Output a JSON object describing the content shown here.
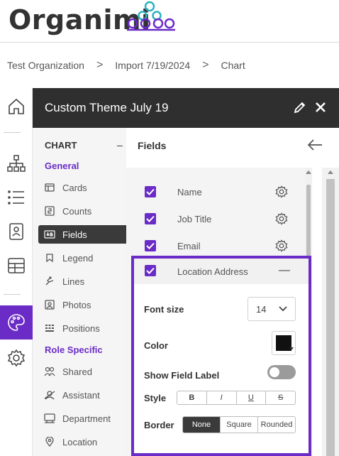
{
  "brand": {
    "name": "Organimi",
    "accent": "#6a2bc7"
  },
  "breadcrumb": {
    "items": [
      "Test Organization",
      "Import 7/19/2024",
      "Chart"
    ],
    "separator": ">"
  },
  "rail": {
    "icons": [
      "home-icon",
      "org-chart-icon",
      "list-icon",
      "badge-icon",
      "table-icon",
      "palette-icon",
      "settings-icon"
    ],
    "active": "palette-icon"
  },
  "panel": {
    "title": "Custom Theme July 19"
  },
  "nav": {
    "section": "CHART",
    "collapse": "–",
    "general_label": "General",
    "general_items": [
      "Cards",
      "Counts",
      "Fields",
      "Legend",
      "Lines",
      "Photos",
      "Positions"
    ],
    "active_item": "Fields",
    "role_label": "Role Specific",
    "role_items": [
      "Shared",
      "Assistant",
      "Department",
      "Location"
    ]
  },
  "content": {
    "title": "Fields",
    "fields": [
      "Name",
      "Job Title",
      "Email"
    ],
    "selected_field": "Location Address",
    "options": {
      "font_size_label": "Font size",
      "font_size_value": "14",
      "color_label": "Color",
      "color_value": "#111111",
      "show_label_label": "Show Field Label",
      "show_label_on": false,
      "style_label": "Style",
      "style_buttons": [
        "B",
        "I",
        "U",
        "S"
      ],
      "border_label": "Border",
      "border_options": [
        "None",
        "Square",
        "Rounded"
      ],
      "border_selected": "None"
    }
  }
}
